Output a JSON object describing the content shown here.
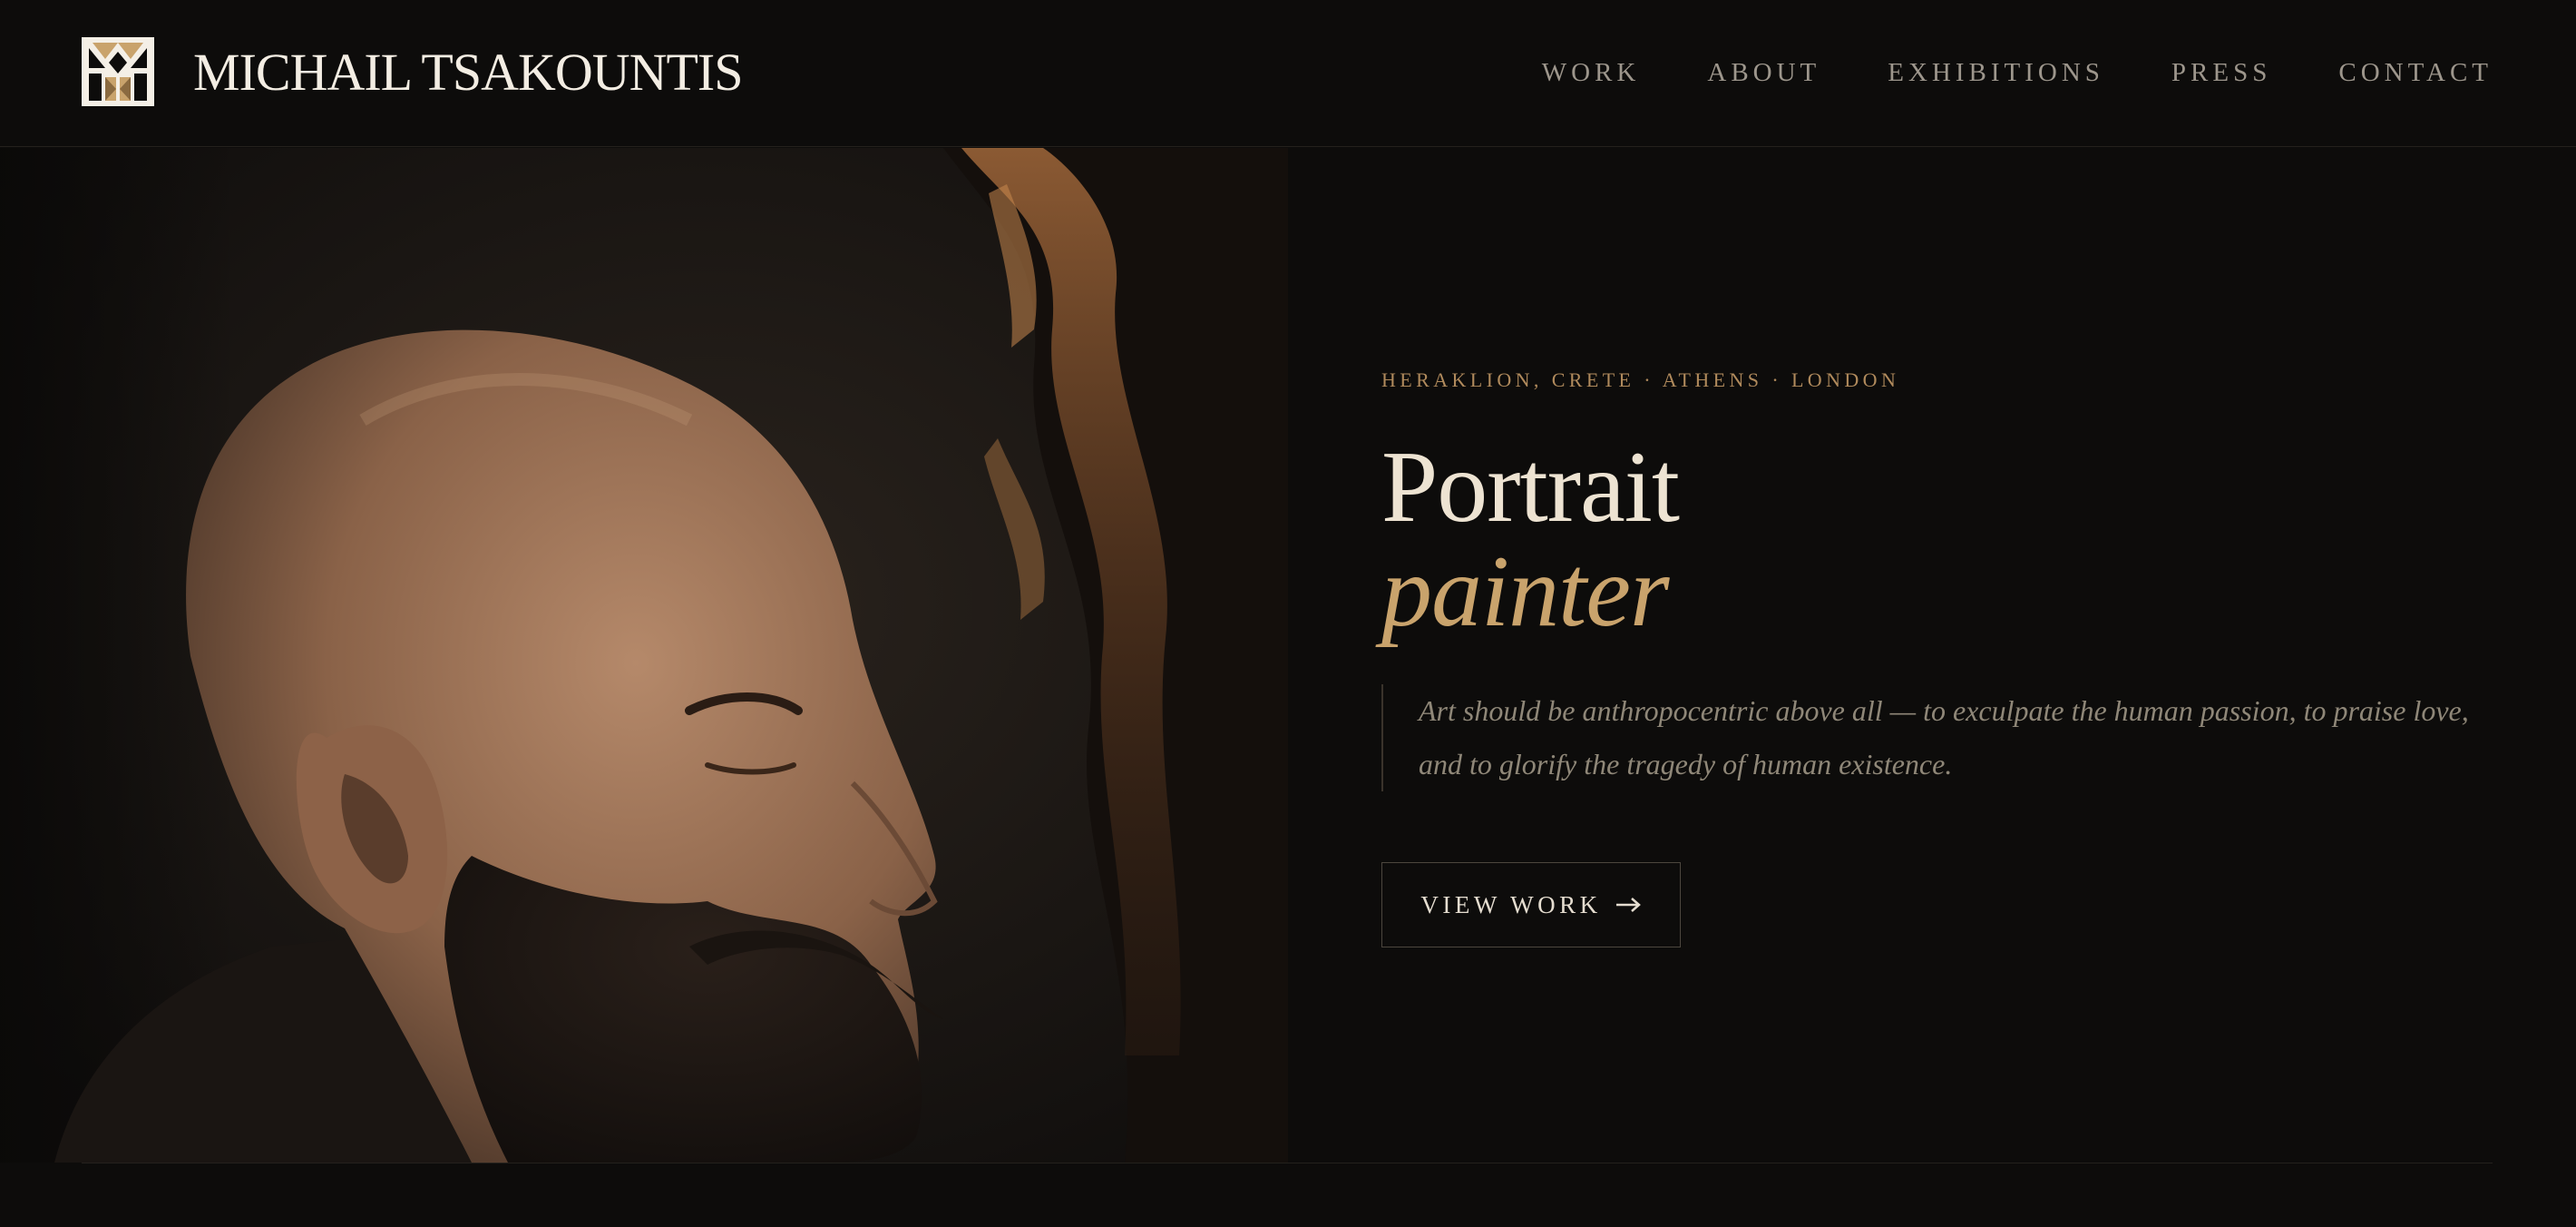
{
  "header": {
    "brand": "MICHAIL TSAKOUNTIS",
    "logo_icon": "mt-monogram-icon",
    "nav": [
      "WORK",
      "ABOUT",
      "EXHIBITIONS",
      "PRESS",
      "CONTACT"
    ]
  },
  "hero": {
    "image_subject": "artist-profile-portrait",
    "location": "HERAKLION, CRETE · ATHENS · LONDON",
    "title_line1": "Portrait",
    "title_line2": "painter",
    "quote": "Art should be anthropocentric above all — to exculpate the human passion, to praise love, and to glorify the tragedy of human existence.",
    "cta_label": "VIEW WORK",
    "cta_icon": "arrow-right-icon"
  },
  "colors": {
    "background": "#0d0c0b",
    "accent_gold": "#c9a36c",
    "text_light": "#ede3d2",
    "text_muted": "#8f8778"
  }
}
